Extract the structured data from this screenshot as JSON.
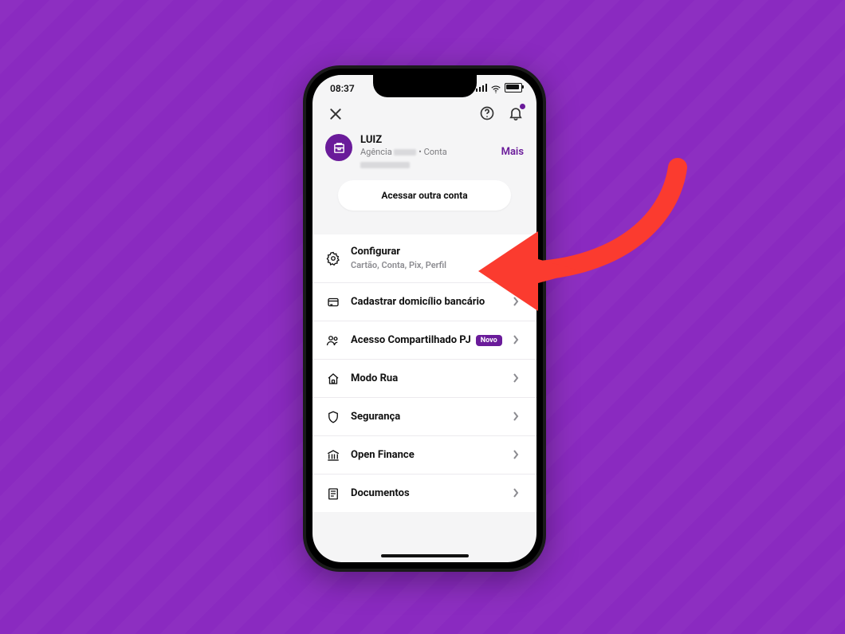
{
  "statusbar": {
    "time": "08:37"
  },
  "account": {
    "name": "LUIZ",
    "sub_prefix": "Agência",
    "sub_account_word": "Conta",
    "more": "Mais"
  },
  "switch_label": "Acessar outra conta",
  "menu": {
    "configurar": {
      "title": "Configurar",
      "sub": "Cartão, Conta, Pix, Perfil"
    },
    "domicilio": {
      "title": "Cadastrar domicílio bancário"
    },
    "acesso": {
      "title": "Acesso Compartilhado PJ",
      "badge": "Novo"
    },
    "modorua": {
      "title": "Modo Rua"
    },
    "seguranca": {
      "title": "Segurança"
    },
    "openfin": {
      "title": "Open Finance"
    },
    "docs": {
      "title": "Documentos"
    }
  },
  "colors": {
    "brand": "#6a1b9a",
    "arrow": "#fb3b2f"
  }
}
